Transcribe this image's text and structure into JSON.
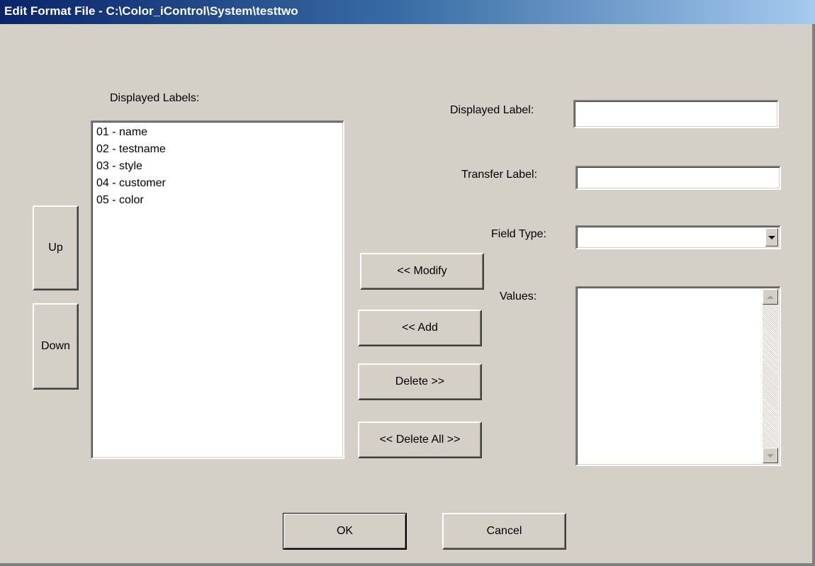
{
  "window": {
    "title": "Edit Format File - C:\\Color_iControl\\System\\testtwo"
  },
  "labels": {
    "displayed_labels": "Displayed Labels:",
    "displayed_label": "Displayed Label:",
    "transfer_label": "Transfer Label:",
    "field_type": "Field Type:",
    "values": "Values:"
  },
  "list_items": [
    "01 - name",
    "02 - testname",
    "03 - style",
    "04 - customer",
    "05 - color"
  ],
  "inputs": {
    "displayed_label_value": "",
    "transfer_label_value": "",
    "field_type_value": ""
  },
  "buttons": {
    "up": "Up",
    "down": "Down",
    "modify": "<< Modify",
    "add": "<< Add",
    "delete": "Delete >>",
    "delete_all": "<< Delete All >>",
    "ok": "OK",
    "cancel": "Cancel"
  },
  "colors": {
    "face": "#d4d0c8",
    "title_start": "#0a246a",
    "title_end": "#a6caf0"
  }
}
